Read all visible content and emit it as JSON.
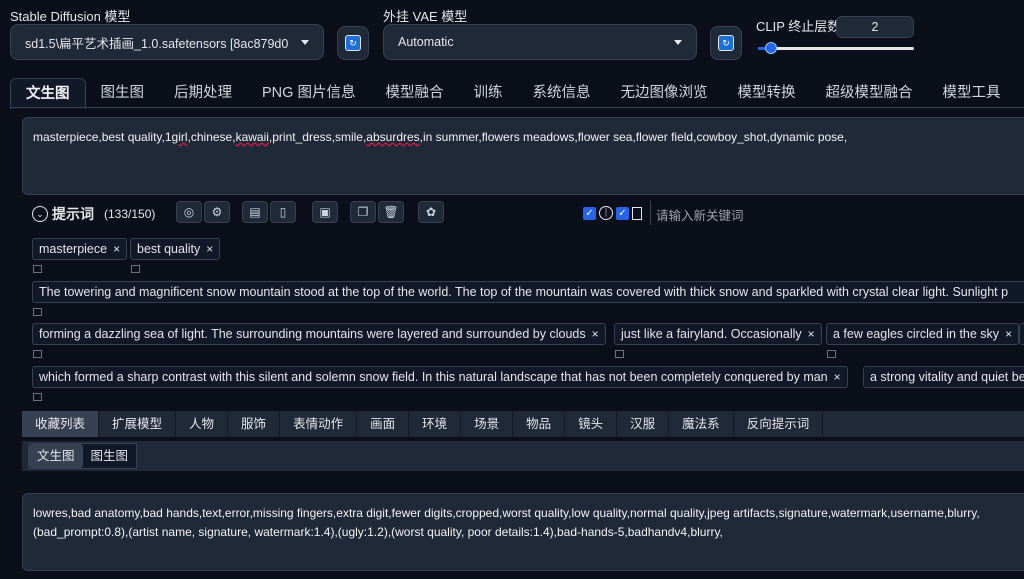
{
  "header": {
    "sd_model_label": "Stable Diffusion 模型",
    "sd_model_value": "sd1.5\\扁平艺术插画_1.0.safetensors [8ac879d0",
    "vae_label": "外挂 VAE 模型",
    "vae_value": "Automatic",
    "clip_label": "CLIP 终止层数",
    "clip_value": "2",
    "clip_slider_fraction": 0.083
  },
  "tabs": [
    "文生图",
    "图生图",
    "后期处理",
    "PNG 图片信息",
    "模型融合",
    "训练",
    "系统信息",
    "无边图像浏览",
    "模型转换",
    "超级模型融合",
    "模型工具"
  ],
  "prompt": {
    "text_before": "masterpiece,best quality,1",
    "text_wavy1": "girl",
    "text_mid": ",chinese,",
    "text_wavy2": "kawaii",
    "text_mid2": ",print_dress,smile,",
    "text_wavy3": "absurdres",
    "text_after": ",in summer,flowers meadows,flower sea,flower field,cowboy_shot,dynamic pose,"
  },
  "prompt_toolbar": {
    "title": "提示词",
    "count": "(133/150)",
    "keyword_placeholder": "请输入新关键词"
  },
  "tags": {
    "row1": [
      "masterpiece",
      "best quality"
    ],
    "row2": "The towering and magnificent snow mountain stood at the top of the world. The top of the mountain was covered with thick snow and sparkled with crystal clear light. Sunlight p",
    "row3": [
      "forming a dazzling sea of light. The surrounding mountains were layered and surrounded by clouds",
      "just like a fairyland. Occasionally",
      "a few eagles circled in the sky"
    ],
    "row4": [
      "which formed a sharp contrast with this silent and solemn snow field. In this natural landscape that has not been completely conquered by man",
      "a strong vitality and quiet be"
    ]
  },
  "categories": [
    "收藏列表",
    "扩展模型",
    "人物",
    "服饰",
    "表情动作",
    "画面",
    "环境",
    "场景",
    "物品",
    "镜头",
    "汉服",
    "魔法系",
    "反向提示词"
  ],
  "sub_tabs": [
    "文生图",
    "图生图"
  ],
  "negative_prompt": {
    "line1": "lowres,bad anatomy,bad hands,text,error,missing fingers,extra digit,fewer digits,cropped,worst quality,low quality,normal quality,jpeg artifacts,signature,watermark,username,blurry,",
    "line2": "(bad_prompt:0.8),(artist name, signature, watermark:1.4),(ugly:1.2),(worst quality, poor details:1.4),bad-hands-5,badhandv4,blurry,"
  }
}
